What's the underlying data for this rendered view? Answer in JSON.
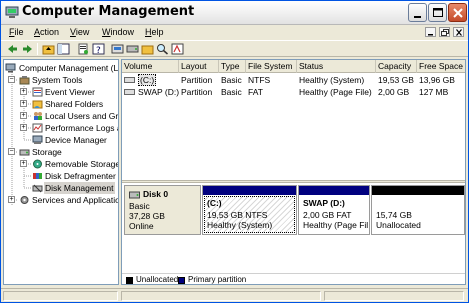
{
  "window": {
    "title": "Computer Management"
  },
  "menu": {
    "items": [
      "File",
      "Action",
      "View",
      "Window",
      "Help"
    ],
    "accelerators": [
      "F",
      "A",
      "V",
      "W",
      "H"
    ]
  },
  "toolbar": {
    "icons": [
      "back-arrow-icon",
      "forward-arrow-icon",
      "up-folder-icon",
      "show-hide-tree-icon",
      "properties-icon",
      "help-icon",
      "connect-icon",
      "disk-icon",
      "explore-icon",
      "search-icon",
      "format-icon"
    ]
  },
  "tree": {
    "items": [
      {
        "label": "Computer Management (L",
        "icon": "computer-icon"
      },
      {
        "label": "System Tools",
        "icon": "tools-icon",
        "expander": "−"
      },
      {
        "label": "Event Viewer",
        "icon": "event-viewer-icon",
        "expander": "+"
      },
      {
        "label": "Shared Folders",
        "icon": "shared-folder-icon",
        "expander": "+"
      },
      {
        "label": "Local Users and Gro",
        "icon": "users-icon",
        "expander": "+"
      },
      {
        "label": "Performance Logs a",
        "icon": "performance-icon",
        "expander": "+"
      },
      {
        "label": "Device Manager",
        "icon": "device-manager-icon"
      },
      {
        "label": "Storage",
        "icon": "storage-icon",
        "expander": "−"
      },
      {
        "label": "Removable Storage",
        "icon": "removable-storage-icon",
        "expander": "+"
      },
      {
        "label": "Disk Defragmenter",
        "icon": "defrag-icon"
      },
      {
        "label": "Disk Management",
        "icon": "disk-management-icon"
      },
      {
        "label": "Services and Applicatio",
        "icon": "services-icon",
        "expander": "+"
      }
    ],
    "selected": "Disk Management"
  },
  "volumes": {
    "columns": [
      "Volume",
      "Layout",
      "Type",
      "File System",
      "Status",
      "Capacity",
      "Free Space"
    ],
    "rows": [
      [
        "(C:)",
        "Partition",
        "Basic",
        "NTFS",
        "Healthy (System)",
        "19,53 GB",
        "13,96 GB"
      ],
      [
        "SWAP (D:)",
        "Partition",
        "Basic",
        "FAT",
        "Healthy (Page File)",
        "2,00 GB",
        "127 MB"
      ]
    ]
  },
  "disk": {
    "name": "Disk 0",
    "type": "Basic",
    "size": "37,28 GB",
    "status": "Online",
    "partitions": [
      {
        "title": "(C:)",
        "line1": "19,53 GB NTFS",
        "line2": "Healthy (System)",
        "color": "#00007f"
      },
      {
        "title": "SWAP  (D:)",
        "line1": "2,00 GB FAT",
        "line2": "Healthy (Page Fil",
        "color": "#00007f"
      },
      {
        "title": "",
        "line1": "15,74 GB",
        "line2": "Unallocated",
        "color": "#000000"
      }
    ]
  },
  "legend": [
    {
      "label": "Unallocated",
      "color": "#000000"
    },
    {
      "label": "Primary partition",
      "color": "#00007f"
    }
  ]
}
